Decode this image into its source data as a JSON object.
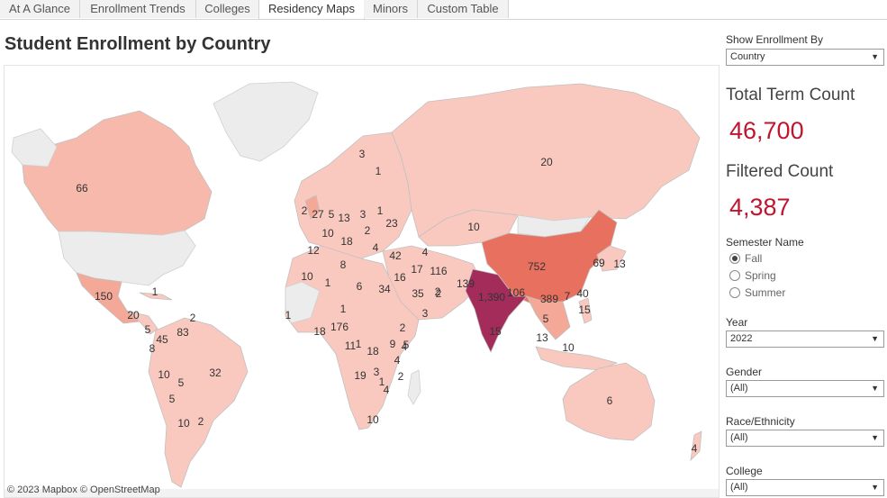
{
  "tabs": [
    "At A Glance",
    "Enrollment Trends",
    "Colleges",
    "Residency Maps",
    "Minors",
    "Custom Table"
  ],
  "active_tab": "Residency Maps",
  "page_title": "Student Enrollment by Country",
  "map": {
    "credit": "© 2023 Mapbox  © OpenStreetMap",
    "colors": {
      "ocean": "#ffffff",
      "no_data": "#ececec",
      "low": "#f9c9bf",
      "mid": "#f3a898",
      "high_china": "#e8705f",
      "highest_india": "#a42c5a"
    },
    "labels": [
      {
        "text": "66",
        "country": "Canada"
      },
      {
        "text": "20",
        "country": "Russia"
      },
      {
        "text": "3",
        "country": "Norway"
      },
      {
        "text": "1",
        "country": "Finland"
      },
      {
        "text": "2",
        "country": "Ireland"
      },
      {
        "text": "27",
        "country": "United Kingdom"
      },
      {
        "text": "5",
        "country": "Netherlands"
      },
      {
        "text": "13",
        "country": "Germany"
      },
      {
        "text": "3",
        "country": "Poland"
      },
      {
        "text": "1",
        "country": "Belarus"
      },
      {
        "text": "23",
        "country": "Ukraine"
      },
      {
        "text": "10",
        "country": "France"
      },
      {
        "text": "18",
        "country": "Italy"
      },
      {
        "text": "2",
        "country": "Romania"
      },
      {
        "text": "10",
        "country": "Kazakhstan"
      },
      {
        "text": "12",
        "country": "Spain"
      },
      {
        "text": "4",
        "country": "Greece"
      },
      {
        "text": "42",
        "country": "Turkey"
      },
      {
        "text": "4",
        "country": "Georgia"
      },
      {
        "text": "17",
        "country": "Iran"
      },
      {
        "text": "116",
        "country": "Afghanistan"
      },
      {
        "text": "16",
        "country": "Iraq"
      },
      {
        "text": "8",
        "country": "Tunisia"
      },
      {
        "text": "10",
        "country": "Morocco"
      },
      {
        "text": "1",
        "country": "Algeria"
      },
      {
        "text": "6",
        "country": "Libya"
      },
      {
        "text": "34",
        "country": "Egypt"
      },
      {
        "text": "35",
        "country": "Saudi Arabia"
      },
      {
        "text": "2",
        "country": "UAE"
      },
      {
        "text": "139",
        "country": "Pakistan"
      },
      {
        "text": "1,390",
        "country": "India"
      },
      {
        "text": "752",
        "country": "China"
      },
      {
        "text": "106",
        "country": "Bangladesh"
      },
      {
        "text": "389",
        "country": "Vietnam"
      },
      {
        "text": "7",
        "country": "Philippines-north"
      },
      {
        "text": "40",
        "country": "Taiwan"
      },
      {
        "text": "69",
        "country": "South Korea"
      },
      {
        "text": "13",
        "country": "Japan"
      },
      {
        "text": "15",
        "country": "Philippines"
      },
      {
        "text": "15",
        "country": "Sri Lanka"
      },
      {
        "text": "5",
        "country": "Malaysia"
      },
      {
        "text": "13",
        "country": "Singapore"
      },
      {
        "text": "10",
        "country": "Indonesia"
      },
      {
        "text": "6",
        "country": "Australia"
      },
      {
        "text": "4",
        "country": "New Zealand"
      },
      {
        "text": "150",
        "country": "Mexico"
      },
      {
        "text": "1",
        "country": "Cuba"
      },
      {
        "text": "20",
        "country": "Honduras"
      },
      {
        "text": "5",
        "country": "Costa Rica"
      },
      {
        "text": "2",
        "country": "Trinidad"
      },
      {
        "text": "45",
        "country": "Colombia"
      },
      {
        "text": "83",
        "country": "Venezuela"
      },
      {
        "text": "8",
        "country": "Ecuador"
      },
      {
        "text": "10",
        "country": "Peru"
      },
      {
        "text": "5",
        "country": "Bolivia"
      },
      {
        "text": "32",
        "country": "Brazil"
      },
      {
        "text": "5",
        "country": "Chile"
      },
      {
        "text": "10",
        "country": "Argentina"
      },
      {
        "text": "2",
        "country": "Uruguay"
      },
      {
        "text": "1",
        "country": "Senegal"
      },
      {
        "text": "1",
        "country": "Sudan"
      },
      {
        "text": "2",
        "country": "Ethiopia"
      },
      {
        "text": "18",
        "country": "Ghana"
      },
      {
        "text": "176",
        "country": "Nigeria"
      },
      {
        "text": "3",
        "country": "Yemen"
      },
      {
        "text": "5",
        "country": "Somalia"
      },
      {
        "text": "1",
        "country": "Cameroon"
      },
      {
        "text": "11",
        "country": "Gabon"
      },
      {
        "text": "18",
        "country": "DR Congo"
      },
      {
        "text": "9",
        "country": "Uganda"
      },
      {
        "text": "4",
        "country": "Kenya"
      },
      {
        "text": "4",
        "country": "Tanzania"
      },
      {
        "text": "19",
        "country": "Angola"
      },
      {
        "text": "3",
        "country": "Zambia"
      },
      {
        "text": "2",
        "country": "Malawi"
      },
      {
        "text": "1",
        "country": "Zimbabwe"
      },
      {
        "text": "4",
        "country": "Mozambique"
      },
      {
        "text": "10",
        "country": "South Africa"
      },
      {
        "text": "2",
        "country": "Lebanon"
      }
    ]
  },
  "sidebar": {
    "show_by_label": "Show Enrollment By",
    "show_by_value": "Country",
    "total_label": "Total Term Count",
    "total_value": "46,700",
    "filtered_label": "Filtered Count",
    "filtered_value": "4,387",
    "semester_label": "Semester Name",
    "semesters": [
      "Fall",
      "Spring",
      "Summer"
    ],
    "semester_selected": "Fall",
    "year_label": "Year",
    "year_value": "2022",
    "gender_label": "Gender",
    "gender_value": "(All)",
    "race_label": "Race/Ethnicity",
    "race_value": "(All)",
    "college_label": "College",
    "college_value": "(All)"
  }
}
